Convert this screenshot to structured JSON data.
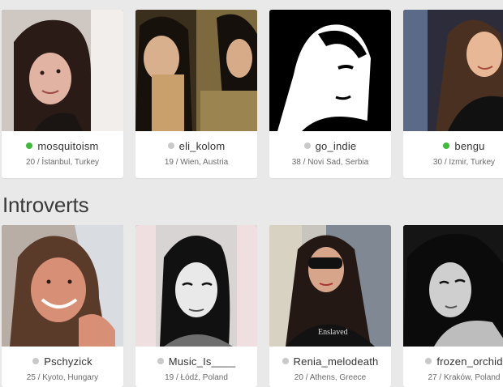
{
  "top_row": [
    {
      "username": "mosquitoism",
      "status": "online",
      "info": "20 / İstanbul, Turkey",
      "photo_icon": "profile-photo"
    },
    {
      "username": "eli_kolom",
      "status": "offline",
      "info": "19 / Wien, Austria",
      "photo_icon": "profile-photo"
    },
    {
      "username": "go_indie",
      "status": "offline",
      "info": "38 / Novi Sad, Serbia",
      "photo_icon": "profile-photo"
    },
    {
      "username": "bengu",
      "status": "online",
      "info": "30 / Izmir, Turkey",
      "photo_icon": "profile-photo"
    }
  ],
  "section": {
    "title": "Introverts"
  },
  "bottom_row": [
    {
      "username": "Pschyzick",
      "status": "offline",
      "info": "25 / Kyoto, Hungary",
      "photo_icon": "profile-photo"
    },
    {
      "username": "Music_Is____",
      "status": "offline",
      "info": "19 / Łódź, Poland",
      "photo_icon": "profile-photo"
    },
    {
      "username": "Renia_melodeath",
      "status": "offline",
      "info": "20 / Athens, Greece",
      "photo_icon": "profile-photo"
    },
    {
      "username": "frozen_orchid",
      "status": "offline",
      "info": "27 / Kraków, Poland",
      "photo_icon": "profile-photo"
    }
  ],
  "colors": {
    "online": "#3fbb3b",
    "offline": "#c9c9c9",
    "background": "#e9e9e9"
  }
}
